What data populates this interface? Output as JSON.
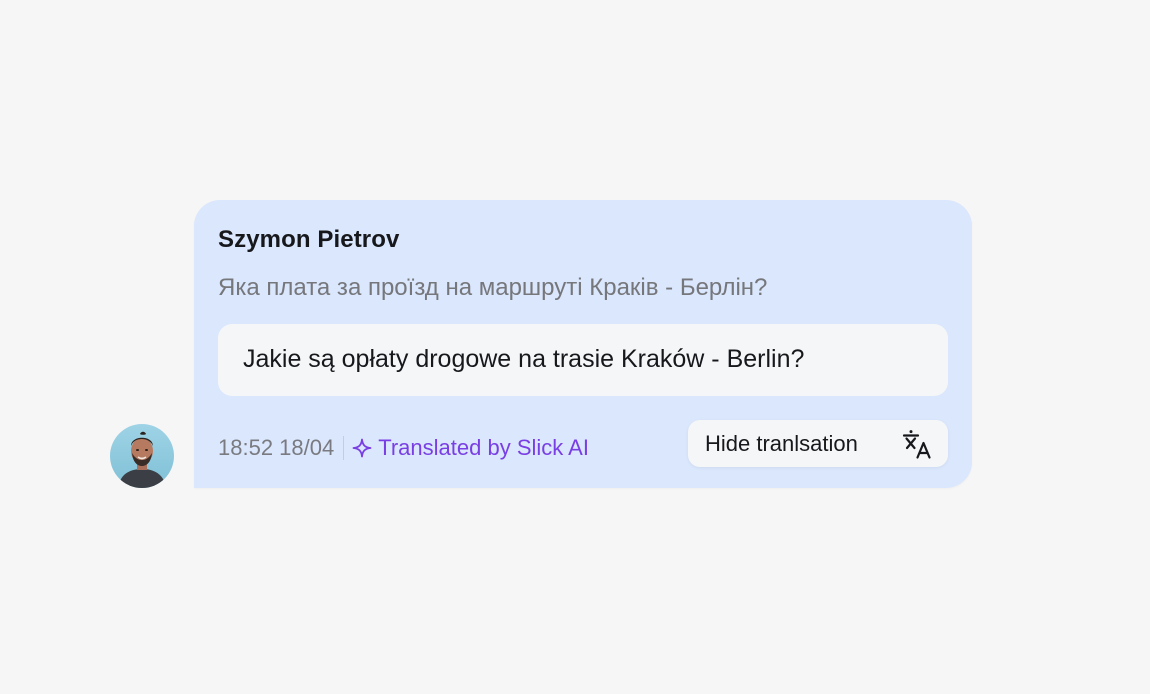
{
  "message": {
    "sender": "Szymon Pietrov",
    "original_text": "Яка плата за проїзд на маршруті Краків - Берлін?",
    "translated_text": "Jakie są opłaty drogowe na trasie Kraków - Berlin?",
    "timestamp": "18:52 18/04",
    "translated_by_label": "Translated by Slick AI",
    "hide_translation_label": "Hide tranlsation"
  },
  "icons": {
    "avatar": "user-avatar-photo",
    "sparkle": "sparkle-icon",
    "translate": "translate-icon"
  },
  "colors": {
    "page_background": "#f6f6f6",
    "bubble_background": "#dae7fd",
    "translation_box_background": "#f5f6f8",
    "ai_accent": "#7a3fe4",
    "muted_text": "#76777b",
    "primary_text": "#17181c"
  }
}
